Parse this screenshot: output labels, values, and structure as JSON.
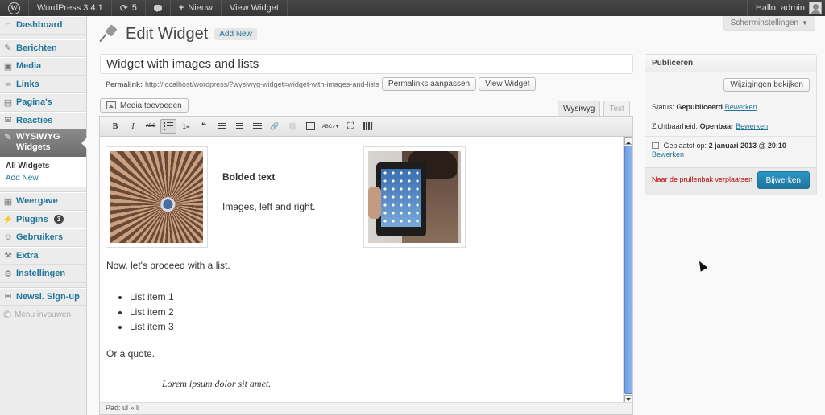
{
  "adminbar": {
    "site_name": "WordPress 3.4.1",
    "updates_count": "5",
    "new_label": "Nieuw",
    "view_label": "View Widget",
    "greeting": "Hallo, admin"
  },
  "sidebar": {
    "items": [
      {
        "label": "Dashboard",
        "icon": "home-icon"
      },
      {
        "label": "Berichten",
        "icon": "pin-icon"
      },
      {
        "label": "Media",
        "icon": "media-icon"
      },
      {
        "label": "Links",
        "icon": "link-icon"
      },
      {
        "label": "Pagina's",
        "icon": "pages-icon"
      },
      {
        "label": "Reacties",
        "icon": "comments-icon"
      },
      {
        "label": "WYSIWYG Widgets",
        "icon": "pin-icon"
      },
      {
        "label": "Weergave",
        "icon": "appearance-icon"
      },
      {
        "label": "Plugins",
        "icon": "plugins-icon",
        "badge": "3"
      },
      {
        "label": "Gebruikers",
        "icon": "users-icon"
      },
      {
        "label": "Extra",
        "icon": "tools-icon"
      },
      {
        "label": "Instellingen",
        "icon": "settings-icon"
      },
      {
        "label": "Newsl. Sign-up",
        "icon": "mail-icon"
      }
    ],
    "submenu": [
      "All Widgets",
      "Add New"
    ],
    "collapse_label": "Menu invouwen"
  },
  "screen_options": "Scherminstellingen",
  "page": {
    "title": "Edit Widget",
    "add_new": "Add New"
  },
  "post": {
    "title": "Widget with images and lists",
    "permalink_label": "Permalink:",
    "permalink_url": "http://localhost/wordpress/?wysiwyg-widget=widget-with-images-and-lists",
    "permalink_button": "Permalinks aanpassen",
    "view_button": "View Widget"
  },
  "editor": {
    "media_button": "Media toevoegen",
    "tabs": [
      "Wysiwyg",
      "Text"
    ],
    "toolbar": [
      {
        "name": "bold-button",
        "label": "B"
      },
      {
        "name": "italic-button",
        "label": "I"
      },
      {
        "name": "strikethrough-button",
        "label": "ABC"
      },
      {
        "name": "bullet-list-button",
        "label": ""
      },
      {
        "name": "numbered-list-button",
        "label": "1≡"
      },
      {
        "name": "blockquote-button",
        "label": "❝"
      },
      {
        "name": "align-left-button",
        "label": ""
      },
      {
        "name": "align-center-button",
        "label": ""
      },
      {
        "name": "align-right-button",
        "label": ""
      },
      {
        "name": "insert-link-button",
        "label": "🔗"
      },
      {
        "name": "unlink-button",
        "label": "⛓"
      },
      {
        "name": "more-tag-button",
        "label": ""
      },
      {
        "name": "spellcheck-button",
        "label": "ABC✓▾"
      },
      {
        "name": "fullscreen-button",
        "label": "⛶"
      },
      {
        "name": "kitchen-sink-button",
        "label": ""
      }
    ],
    "content": {
      "bold_text": "Bolded text",
      "side_text": "Images, left and right.",
      "list_intro": "Now, let's proceed with a list.",
      "list_items": [
        "List item 1",
        "List item 2",
        "List item 3"
      ],
      "quote_intro": "Or a quote.",
      "quote": "Lorem ipsum dolor sit amet."
    },
    "path": "Pad: ul » li"
  },
  "publish": {
    "header": "Publiceren",
    "preview_button": "Wijzigingen bekijken",
    "status_label": "Status:",
    "status_value": "Gepubliceerd",
    "visibility_label": "Zichtbaarheid:",
    "visibility_value": "Openbaar",
    "date_label": "Geplaatst op:",
    "date_value": "2 januari 2013 @ 20:10",
    "edit_link": "Bewerken",
    "trash_link": "Naar de prullenbak verplaatsen",
    "update_button": "Bijwerken"
  }
}
